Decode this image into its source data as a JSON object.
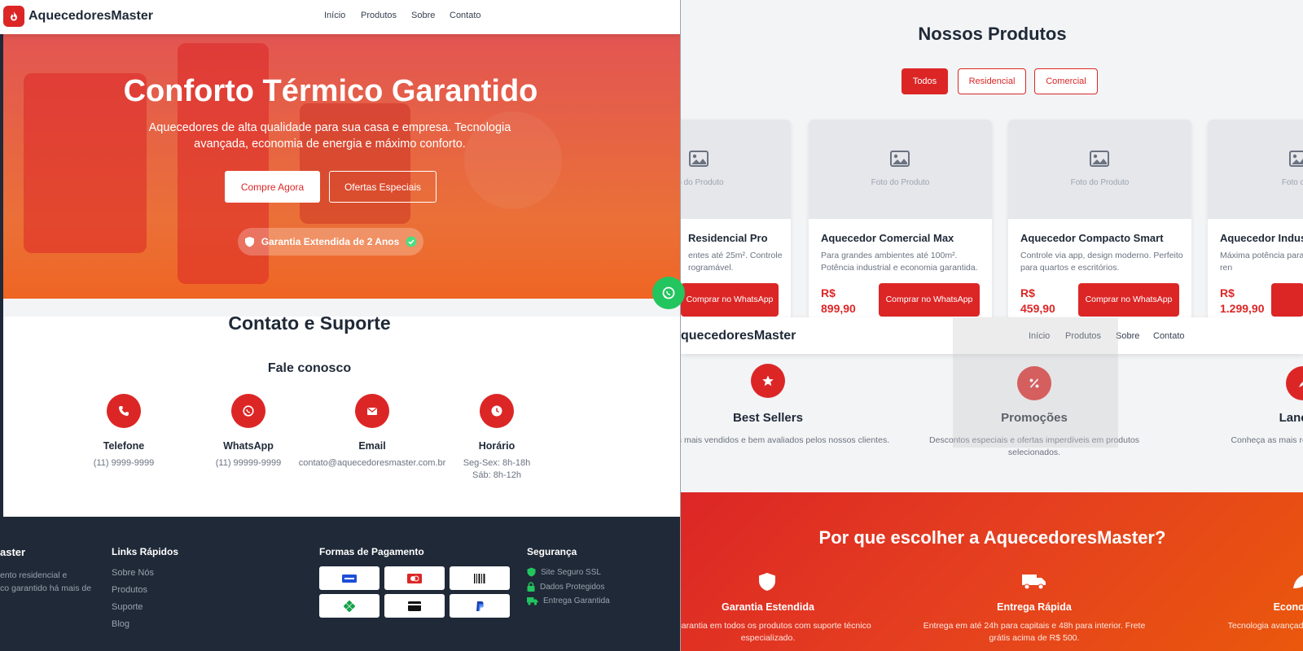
{
  "brand": {
    "name": "AquecedoresMaster"
  },
  "nav": {
    "items": [
      "Início",
      "Produtos",
      "Sobre",
      "Contato"
    ]
  },
  "hero": {
    "title": "Conforto Térmico Garantido",
    "subtitle": "Aquecedores de alta qualidade para sua casa e empresa. Tecnologia avançada, economia de energia e máximo conforto.",
    "primary_button": "Compre Agora",
    "secondary_button": "Ofertas Especiais",
    "badge": "Garantia Extendida de 2 Anos"
  },
  "contact": {
    "title": "Contato e Suporte",
    "subtitle": "Fale conosco",
    "items": [
      {
        "icon": "phone-icon",
        "label": "Telefone",
        "value": "(11) 9999-9999"
      },
      {
        "icon": "whatsapp-icon",
        "label": "WhatsApp",
        "value": "(11) 99999-9999"
      },
      {
        "icon": "email-icon",
        "label": "Email",
        "value": "contato@aquecedoresmaster.com.br"
      },
      {
        "icon": "clock-icon",
        "label": "Horário",
        "value": "Seg-Sex: 8h-18h",
        "value2": "Sáb: 8h-12h"
      }
    ]
  },
  "footer": {
    "brand_partial": "aster",
    "about_lines": [
      "ento residencial e",
      "co garantido há mais de"
    ],
    "links_title": "Links Rápidos",
    "links": [
      "Sobre Nós",
      "Produtos",
      "Suporte",
      "Blog"
    ],
    "payments_title": "Formas de Pagamento",
    "payments": [
      "visa",
      "mastercard",
      "boleto",
      "pix",
      "card",
      "paypal"
    ],
    "security_title": "Segurança",
    "security": [
      "Site Seguro SSL",
      "Dados Protegidos",
      "Entrega Garantida"
    ]
  },
  "products": {
    "title": "Nossos Produtos",
    "filters": [
      "Todos",
      "Residencial",
      "Comercial"
    ],
    "photo_label": "Foto do Produto",
    "buy_label": "Comprar no WhatsApp",
    "currency": "R$",
    "cards": [
      {
        "name": "Residencial Pro",
        "desc": "entes até 25m². Controle rogramável.",
        "price": "",
        "photo": "to do Produto"
      },
      {
        "name": "Aquecedor Comercial Max",
        "desc": "Para grandes ambientes até 100m². Potência industrial e economia garantida.",
        "price": "899,90",
        "photo": "Foto do Produto"
      },
      {
        "name": "Aquecedor Compacto Smart",
        "desc": "Controle via app, design moderno. Perfeito para quartos e escritórios.",
        "price": "459,90",
        "photo": "Foto do Produto"
      },
      {
        "name": "Aquecedor Indust",
        "desc": "Máxima potência para indústrias. Controle ren",
        "price": "1.299,90",
        "photo": "Foto do P"
      }
    ]
  },
  "nav2": {
    "brand_partial": "quecedoresMaster"
  },
  "categories": [
    {
      "title": "Best Sellers",
      "desc": "ecedores mais vendidos e bem avaliados pelos nossos clientes."
    },
    {
      "title": "Promoções",
      "desc": "Descontos especiais e ofertas imperdíveis em produtos selecionados."
    },
    {
      "title": "Lançam",
      "desc": "Conheça as mais recentes in aquecin"
    }
  ],
  "why": {
    "title": "Por que escolher a AquecedoresMaster?",
    "items": [
      {
        "title": "Garantia Estendida",
        "text": "de garantia em todos os produtos com suporte técnico especializado."
      },
      {
        "title": "Entrega Rápida",
        "text": "Entrega em até 24h para capitais e 48h para interior. Frete grátis acima de R$ 500."
      },
      {
        "title": "Economia d",
        "text": "Tecnologia avançada que reduz a elétri"
      }
    ]
  },
  "colors": {
    "primary": "#dc2626",
    "orange": "#ea580c",
    "dark": "#1f2937",
    "whatsapp": "#22c55e"
  }
}
